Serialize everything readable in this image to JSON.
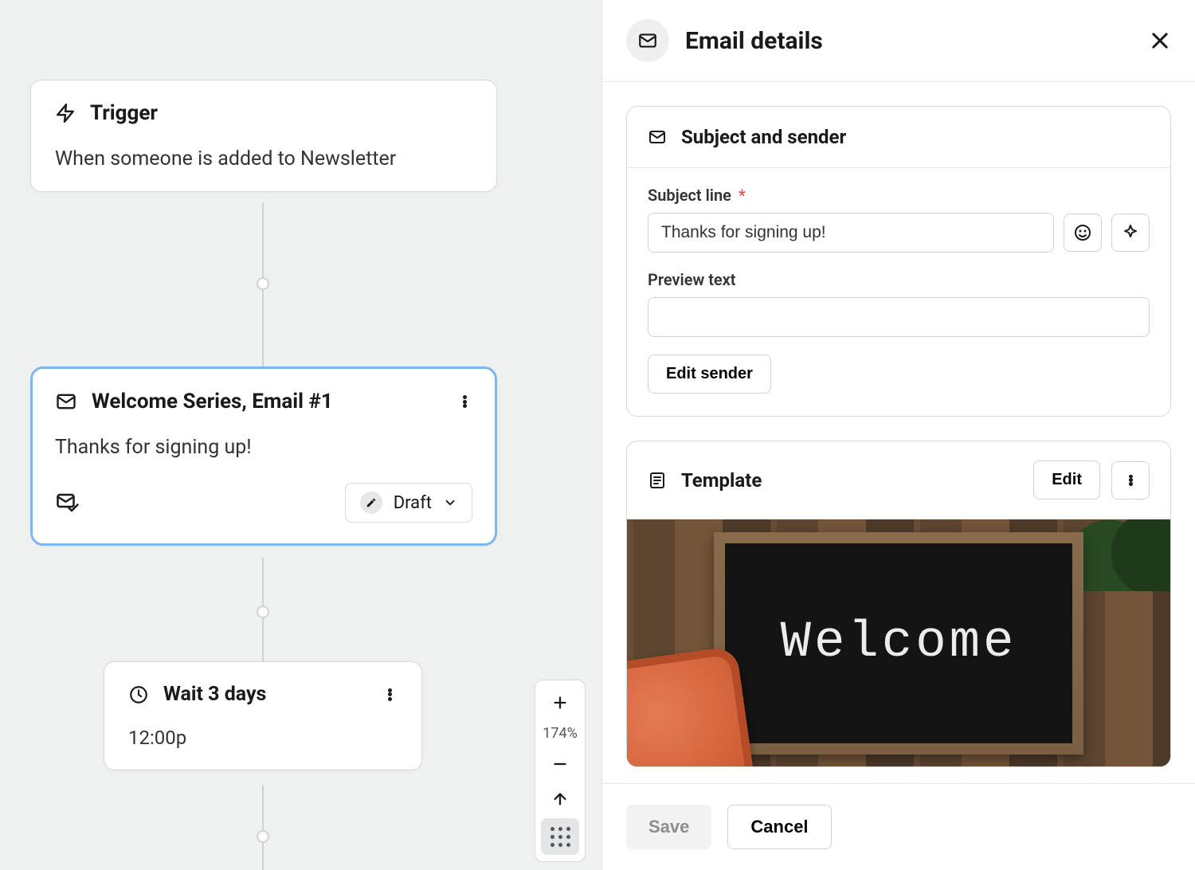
{
  "canvas": {
    "trigger": {
      "title": "Trigger",
      "description": "When someone is added to Newsletter"
    },
    "email": {
      "title": "Welcome Series, Email #1",
      "subject": "Thanks for signing up!",
      "status": "Draft"
    },
    "wait": {
      "title": "Wait 3 days",
      "time": "12:00p"
    },
    "zoom": {
      "level": "174%"
    }
  },
  "panel": {
    "title": "Email details",
    "subject_section": {
      "title": "Subject and sender",
      "subject_label": "Subject line",
      "subject_value": "Thanks for signing up!",
      "preview_label": "Preview text",
      "preview_value": "",
      "edit_sender": "Edit sender"
    },
    "template_section": {
      "title": "Template",
      "edit": "Edit",
      "welcome_text": "Welcome"
    },
    "footer": {
      "save": "Save",
      "cancel": "Cancel"
    }
  }
}
